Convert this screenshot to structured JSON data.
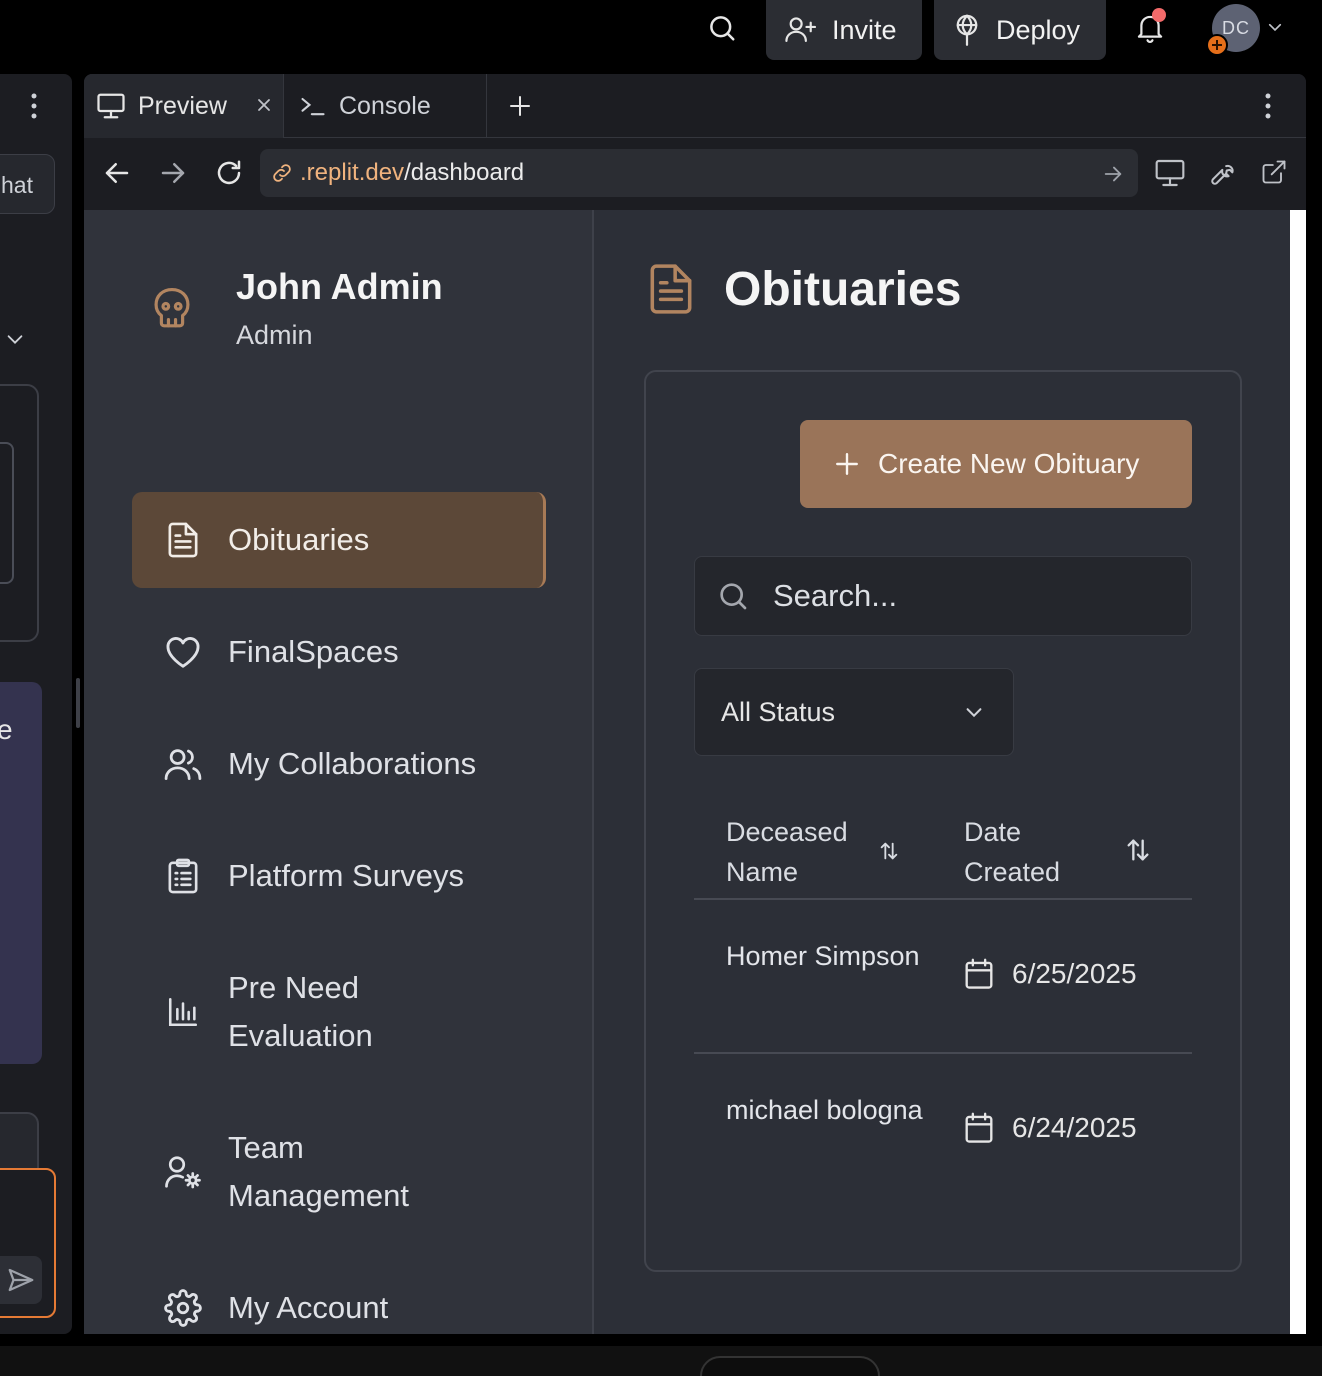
{
  "topbar": {
    "invite_label": "Invite",
    "deploy_label": "Deploy",
    "avatar_initials": "DC"
  },
  "left_pane": {
    "chat_label": "hat",
    "purple_text": "e"
  },
  "tabs": [
    {
      "label": "Preview",
      "icon": "monitor-icon"
    },
    {
      "label": "Console",
      "icon": "terminal-icon"
    }
  ],
  "url": {
    "domain": ".replit.dev",
    "path": "/dashboard"
  },
  "user": {
    "name": "John Admin",
    "role": "Admin",
    "icon": "skull-icon"
  },
  "sidebar": {
    "items": [
      {
        "label": "Obituaries",
        "icon": "file-text-icon",
        "active": true
      },
      {
        "label": "FinalSpaces",
        "icon": "heart-icon"
      },
      {
        "label": "My Collaborations",
        "icon": "users-icon"
      },
      {
        "label": "Platform Surveys",
        "icon": "clipboard-list-icon"
      },
      {
        "label": "Pre Need Evaluation",
        "icon": "bar-chart-icon"
      },
      {
        "label": "Team Management",
        "icon": "user-cog-icon"
      },
      {
        "label": "My Account",
        "icon": "settings-icon"
      }
    ]
  },
  "main": {
    "title": "Obituaries",
    "create_button": "Create New Obituary",
    "search_placeholder": "Search...",
    "status_filter": "All Status",
    "table": {
      "columns": [
        "Deceased Name",
        "Date Created"
      ],
      "rows": [
        {
          "name": "Homer Simpson",
          "date": "6/25/2025"
        },
        {
          "name": "michael bologna",
          "date": "6/24/2025"
        }
      ]
    }
  },
  "colors": {
    "accent": "#9a7459",
    "active_nav": "#5c4838",
    "background": "#2c2f37",
    "sidebar": "#30333b"
  }
}
